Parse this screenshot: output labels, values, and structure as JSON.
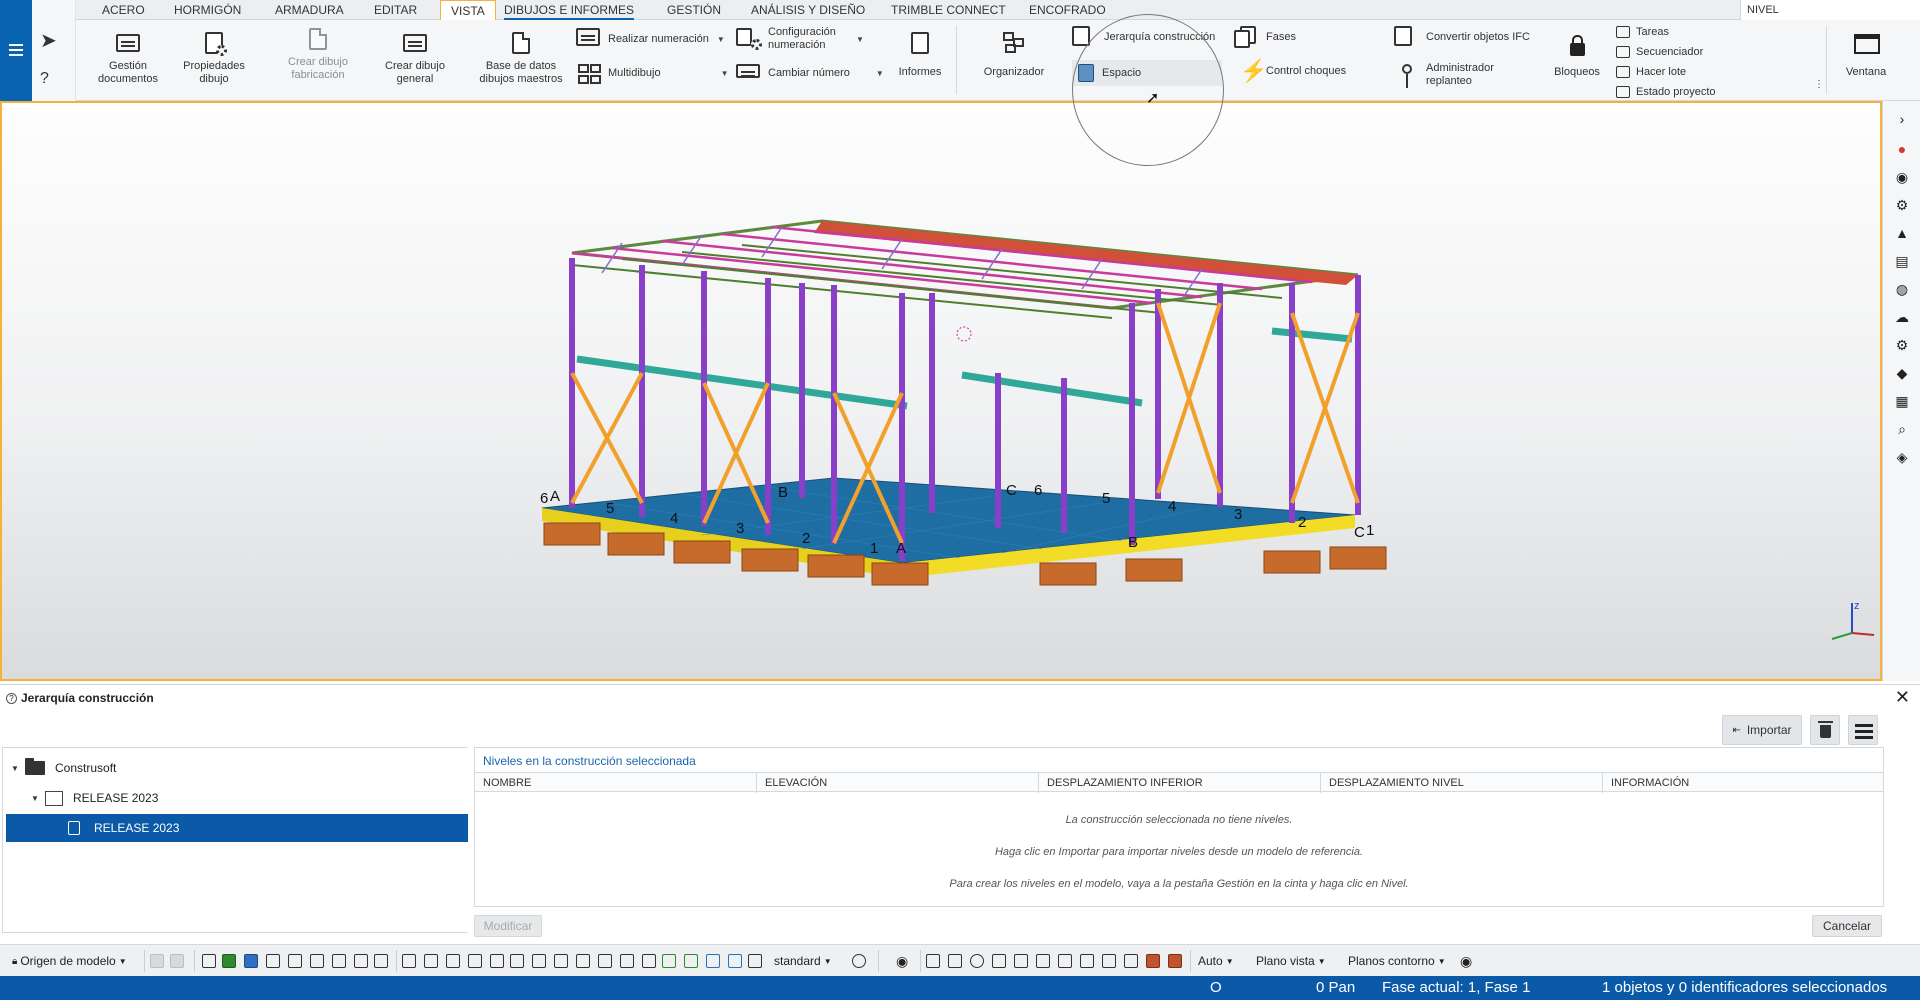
{
  "tabs": [
    "ACERO",
    "HORMIGÓN",
    "ARMADURA",
    "EDITAR",
    "VISTA",
    "DIBUJOS E INFORMES",
    "GESTIÓN",
    "ANÁLISIS Y DISEÑO",
    "TRIMBLE CONNECT",
    "ENCOFRADO"
  ],
  "tab_search": "NIVEL",
  "ribbon": {
    "gestion_documentos": "Gestión documentos",
    "propiedades_dibujo": "Propiedades dibujo",
    "crear_dibujo_fabricacion": "Crear dibujo fabricación",
    "crear_dibujo_general": "Crear dibujo general",
    "base_datos": "Base de datos dibujos maestros",
    "realizar_numeracion": "Realizar numeración",
    "multidibujo": "Multidibujo",
    "configuracion_numeracion": "Configuración numeración",
    "cambiar_numero": "Cambiar número",
    "informes": "Informes",
    "organizador": "Organizador",
    "jerarquia_construccion": "Jerarquía construcción",
    "espacio": "Espacio",
    "fases": "Fases",
    "control_choques": "Control choques",
    "convertir_ifc": "Convertir objetos IFC",
    "administrador_replanteo": "Administrador replanteo",
    "bloqueos": "Bloqueos",
    "tareas": "Tareas",
    "secuenciador": "Secuenciador",
    "hacer_lote": "Hacer lote",
    "estado_proyecto": "Estado proyecto",
    "ventana": "Ventana"
  },
  "model_labels": {
    "left_grid": [
      "6",
      "A",
      "5",
      "4",
      "3",
      "2",
      "1",
      "A"
    ],
    "back_grid": [
      "B",
      "C",
      "6",
      "5",
      "4",
      "3",
      "2",
      "C",
      "1",
      "B"
    ]
  },
  "panel": {
    "title": "Jerarquía construcción",
    "tree": {
      "root": "Construsoft",
      "child": "RELEASE 2023",
      "selected": "RELEASE 2023"
    },
    "levels_title": "Niveles en la construcción seleccionada",
    "columns": [
      "NOMBRE",
      "ELEVACIÓN",
      "DESPLAZAMIENTO INFERIOR",
      "DESPLAZAMIENTO NIVEL",
      "INFORMACIÓN"
    ],
    "messages": [
      "La construcción seleccionada no tiene niveles.",
      "Haga clic en Importar para importar niveles desde un modelo de referencia.",
      "Para crear los niveles en el modelo, vaya a la pestaña Gestión en la cinta y haga clic en Nivel."
    ],
    "import_label": "Importar",
    "modify_label": "Modificar",
    "cancel_label": "Cancelar"
  },
  "bottom_toolbar": {
    "origin": "Origen de modelo",
    "standard": "standard",
    "auto": "Auto",
    "plano_vista": "Plano vista",
    "planos_contorno": "Planos contorno"
  },
  "status": {
    "o": "O",
    "pan": "0 Pan",
    "fase": "Fase actual: 1, Fase 1",
    "selection": "1 objetos y 0 identificadores seleccionados"
  },
  "colors": {
    "accent_blue": "#0a5aa8",
    "viewport_border": "#f4b23c"
  }
}
